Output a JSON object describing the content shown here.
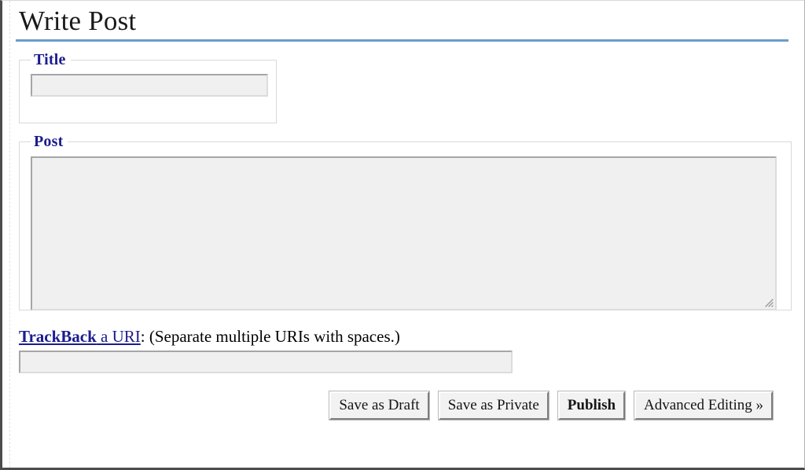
{
  "page": {
    "title": "Write Post"
  },
  "title_field": {
    "legend": "Title",
    "value": "",
    "placeholder": ""
  },
  "post_field": {
    "legend": "Post",
    "value": "",
    "placeholder": "",
    "resize_grip_icon": "resize-grip-icon"
  },
  "trackback": {
    "link_bold": "TrackBack",
    "link_rest": " a URI",
    "tail": ": (Separate multiple URIs with spaces.)",
    "value": "",
    "placeholder": ""
  },
  "buttons": [
    {
      "label": "Save as Draft",
      "name": "save-as-draft-button",
      "bold": false
    },
    {
      "label": "Save as Private",
      "name": "save-as-private-button",
      "bold": false
    },
    {
      "label": "Publish",
      "name": "publish-button",
      "bold": true
    },
    {
      "label": "Advanced Editing »",
      "name": "advanced-editing-button",
      "bold": false
    }
  ],
  "colors": {
    "heading_rule": "#6b9ccb",
    "legend_text": "#1b1b8f",
    "link": "#1b1b8f",
    "input_bg": "#f0f0f0",
    "frame_border": "#4c4c4c"
  }
}
